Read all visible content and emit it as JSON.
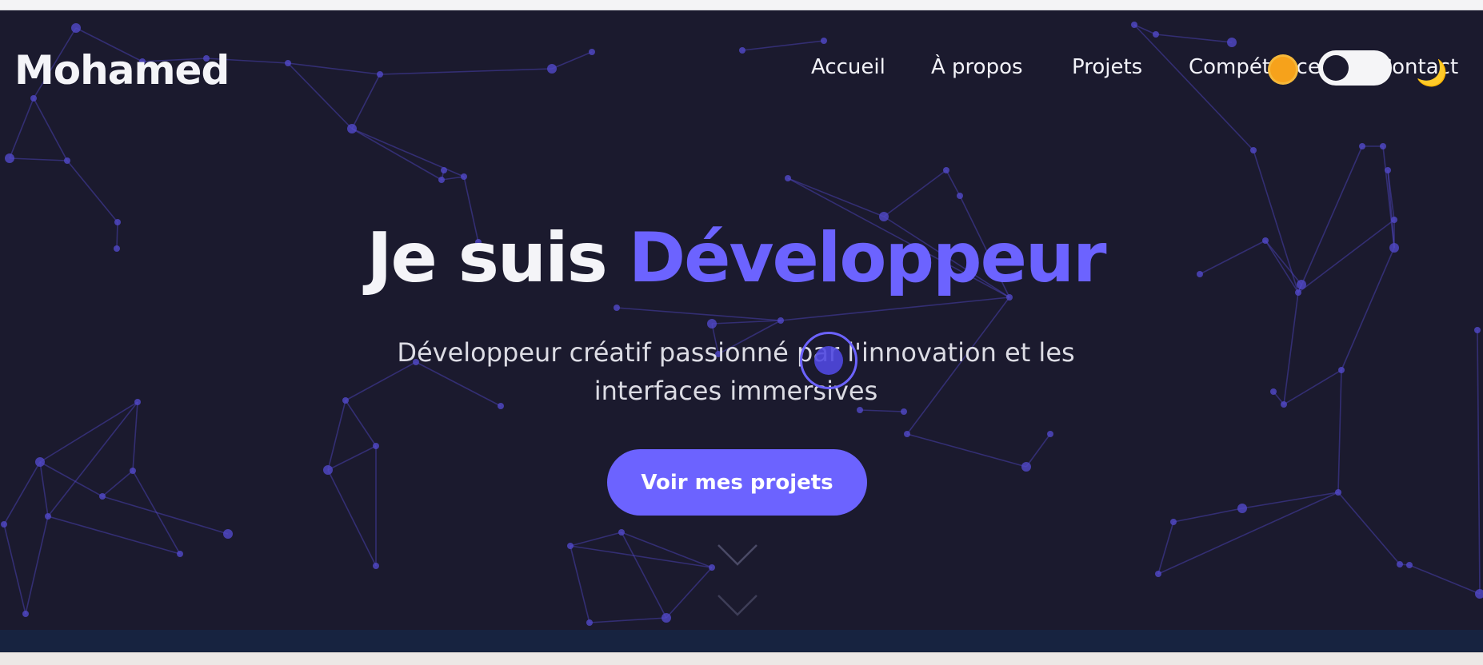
{
  "brand": {
    "name": "Mohamed"
  },
  "nav": {
    "items": [
      {
        "label": "Accueil"
      },
      {
        "label": "À propos"
      },
      {
        "label": "Projets"
      },
      {
        "label": "Compétences"
      },
      {
        "label": "Contact"
      }
    ]
  },
  "theme_toggle": {
    "light_icon": "sun-icon",
    "dark_icon": "moon-icon",
    "state": "dark",
    "moon_glyph": "🌙"
  },
  "hero": {
    "headline_prefix": "Je suis",
    "headline_role": "Développeur",
    "subtitle": "Développeur créatif passionné par l'innovation et les interfaces immersives",
    "cta_label": "Voir mes projets",
    "scroll_icon": "chevron-down-icon"
  },
  "colors": {
    "background": "#1b1a2e",
    "accent": "#6c63ff",
    "text": "#f4f4f8",
    "network": "#5148c8"
  }
}
